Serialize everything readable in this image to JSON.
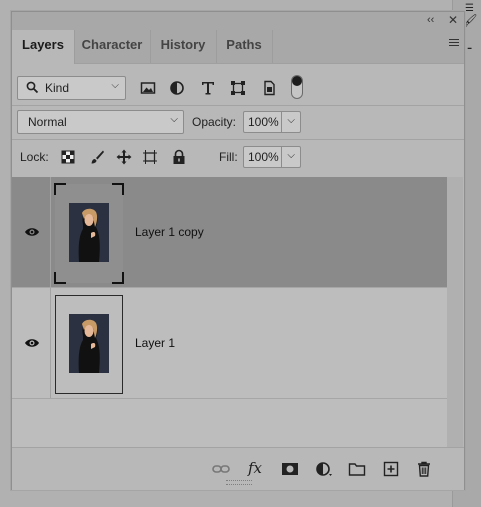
{
  "panel": {
    "collapse_glyph": "‹‹",
    "close_glyph": "✕",
    "tabs": [
      {
        "label": "Layers",
        "active": true
      },
      {
        "label": "Character",
        "active": false
      },
      {
        "label": "History",
        "active": false
      },
      {
        "label": "Paths",
        "active": false
      }
    ]
  },
  "filter": {
    "kind_label": "Kind",
    "icons": [
      "image-filter-icon",
      "adjustment-filter-icon",
      "type-filter-icon",
      "shape-filter-icon",
      "smart-object-filter-icon"
    ],
    "toggle_on": true
  },
  "blend": {
    "mode": "Normal",
    "opacity_label": "Opacity:",
    "opacity_value": "100%",
    "lock_label": "Lock:",
    "fill_label": "Fill:",
    "fill_value": "100%"
  },
  "layers": [
    {
      "name": "Layer 1 copy",
      "visible": true,
      "selected": true
    },
    {
      "name": "Layer 1",
      "visible": true,
      "selected": false
    }
  ],
  "footer_icons": [
    "link-layers-icon",
    "fx-icon",
    "add-mask-icon",
    "adjustment-layer-icon",
    "new-group-icon",
    "new-layer-icon",
    "delete-icon"
  ],
  "footer": {
    "fx_label": "fx"
  },
  "colors": {
    "selected_row": "#8a8a8a",
    "panel_bg": "#b8b8b8"
  }
}
